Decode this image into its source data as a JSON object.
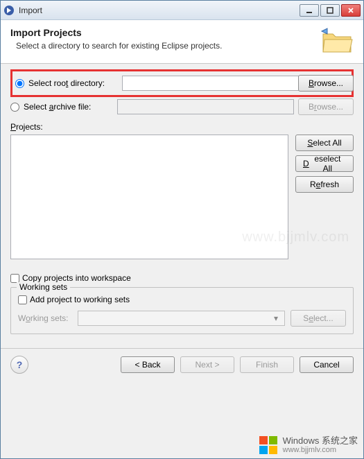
{
  "window": {
    "title": "Import"
  },
  "header": {
    "title": "Import Projects",
    "subtitle": "Select a directory to search for existing Eclipse projects."
  },
  "source": {
    "root_radio_label": "Select root directory:",
    "root_radio_mnemonic": "t",
    "root_value": "",
    "root_browse": "Browse...",
    "archive_radio_label": "Select archive file:",
    "archive_radio_mnemonic": "a",
    "archive_value": "",
    "archive_browse": "Browse..."
  },
  "projects": {
    "label": "Projects:",
    "items": [],
    "select_all": "Select All",
    "deselect_all": "Deselect All",
    "refresh": "Refresh"
  },
  "options": {
    "copy_label": "Copy projects into workspace",
    "copy_checked": false
  },
  "working_sets": {
    "legend": "Working sets",
    "add_label": "Add project to working sets",
    "add_checked": false,
    "combo_label": "Working sets:",
    "combo_value": "",
    "select_button": "Select..."
  },
  "footer": {
    "back": "< Back",
    "next": "Next >",
    "finish": "Finish",
    "cancel": "Cancel"
  },
  "watermark": {
    "line1": "Windows 系统之家",
    "line2": "www.bjjmlv.com",
    "faint": "www.bjjmlv.com"
  }
}
